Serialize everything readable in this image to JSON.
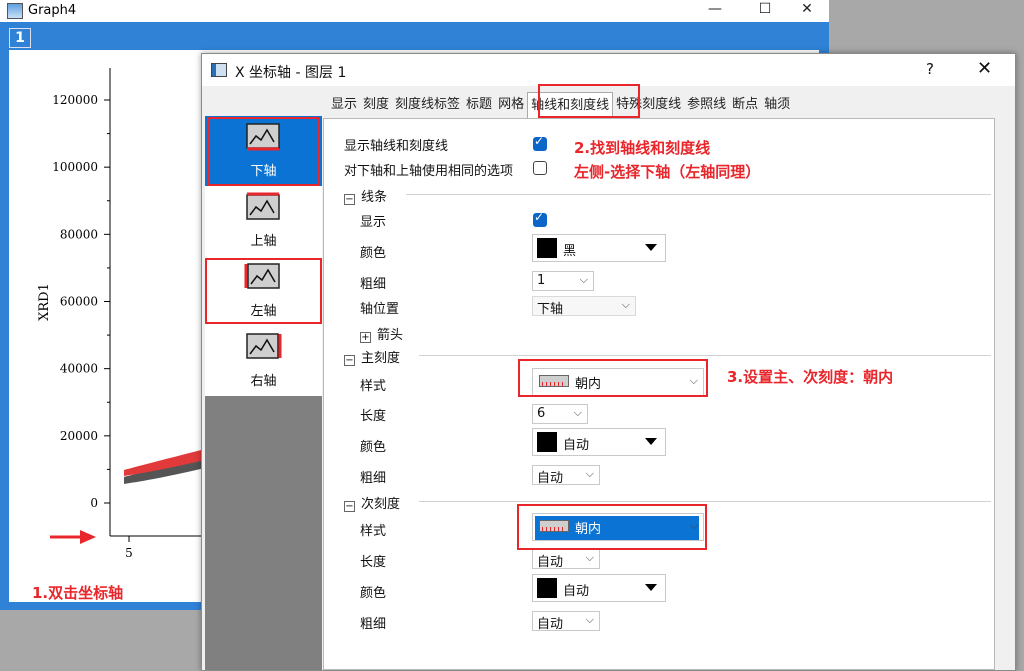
{
  "graph_window": {
    "title": "Graph4",
    "layer_number": "1",
    "controls": {
      "minimize": "—",
      "maximize": "☐",
      "close": "✕"
    }
  },
  "chart_data": {
    "type": "scatter",
    "ylabel": "XRD1",
    "y_ticks": [
      "120000",
      "100000",
      "80000",
      "60000",
      "40000",
      "20000",
      "0"
    ],
    "x_ticks": [
      "5"
    ],
    "ylim": [
      0,
      130000
    ]
  },
  "annotations": {
    "step1": "1.双击坐标轴",
    "step2_line1": "2.找到轴线和刻度线",
    "step2_line2": "左侧-选择下轴（左轴同理）",
    "step3": "3.设置主、次刻度：朝内",
    "highlight_color": "#e8262b"
  },
  "dialog": {
    "title": "X 坐标轴 - 图层 1",
    "help": "?",
    "close": "✕",
    "tabs": [
      {
        "label": "显示"
      },
      {
        "label": "刻度"
      },
      {
        "label": "刻度线标签"
      },
      {
        "label": "标题"
      },
      {
        "label": "网格"
      },
      {
        "label": "轴线和刻度线"
      },
      {
        "label": "特殊刻度线"
      },
      {
        "label": "参照线"
      },
      {
        "label": "断点"
      },
      {
        "label": "轴须"
      }
    ],
    "active_tab": "轴线和刻度线",
    "axes_list": [
      {
        "label": "下轴",
        "icon": "bottom-axis-icon",
        "selected": true
      },
      {
        "label": "上轴",
        "icon": "top-axis-icon",
        "selected": false
      },
      {
        "label": "左轴",
        "icon": "left-axis-icon",
        "selected": false
      },
      {
        "label": "右轴",
        "icon": "right-axis-icon",
        "selected": false
      }
    ],
    "options": {
      "show_axis_ticks_label": "显示轴线和刻度线",
      "show_axis_ticks_checked": true,
      "same_options_label": "对下轴和上轴使用相同的选项",
      "same_options_checked": false
    },
    "line_section": {
      "header": "线条",
      "show_label": "显示",
      "show_checked": true,
      "color_label": "颜色",
      "color_value": "黑",
      "thickness_label": "粗细",
      "thickness_value": "1",
      "position_label": "轴位置",
      "position_value": "下轴",
      "arrow_label": "箭头"
    },
    "major_section": {
      "header": "主刻度",
      "style_label": "样式",
      "style_value": "朝内",
      "length_label": "长度",
      "length_value": "6",
      "color_label": "颜色",
      "color_value": "自动",
      "thickness_label": "粗细",
      "thickness_value": "自动"
    },
    "minor_section": {
      "header": "次刻度",
      "style_label": "样式",
      "style_value": "朝内",
      "length_label": "长度",
      "length_value": "自动",
      "color_label": "颜色",
      "color_value": "自动",
      "thickness_label": "粗细",
      "thickness_value": "自动"
    }
  }
}
